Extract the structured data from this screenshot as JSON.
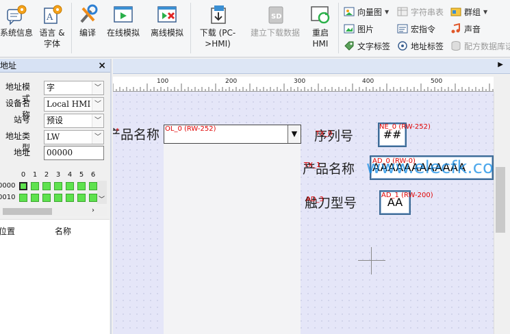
{
  "ribbon": {
    "big_buttons": [
      {
        "label": "系统信息",
        "icon": "system-info-icon",
        "enabled": true
      },
      {
        "label": "语言 &\n字体",
        "icon": "language-font-icon",
        "enabled": true
      },
      {
        "label": "编译",
        "icon": "compile-icon",
        "enabled": true
      },
      {
        "label": "在线模拟",
        "icon": "online-simulation-icon",
        "enabled": true
      },
      {
        "label": "离线模拟",
        "icon": "offline-simulation-icon",
        "enabled": true
      },
      {
        "label": "下载 (PC-\n>HMI)",
        "icon": "download-icon",
        "enabled": true
      },
      {
        "label": "建立下载数据",
        "icon": "build-download-data-icon",
        "enabled": false
      },
      {
        "label": "重启\nHMI",
        "icon": "restart-hmi-icon",
        "enabled": true
      }
    ],
    "small_col1": [
      {
        "label": "向量图",
        "icon": "vector-graphic-icon",
        "dropdown": true,
        "enabled": true
      },
      {
        "label": "图片",
        "icon": "picture-icon",
        "dropdown": false,
        "enabled": true
      },
      {
        "label": "文字标签",
        "icon": "text-tag-icon",
        "dropdown": false,
        "enabled": true
      }
    ],
    "small_col2": [
      {
        "label": "字符串表",
        "icon": "string-table-icon",
        "dropdown": false,
        "enabled": false
      },
      {
        "label": "宏指令",
        "icon": "macro-icon",
        "dropdown": false,
        "enabled": true
      },
      {
        "label": "地址标签",
        "icon": "address-tag-icon",
        "dropdown": false,
        "enabled": true
      }
    ],
    "small_col3": [
      {
        "label": "群组",
        "icon": "group-icon",
        "dropdown": true,
        "enabled": true
      },
      {
        "label": "声音",
        "icon": "sound-icon",
        "dropdown": false,
        "enabled": true
      },
      {
        "label": "配方数据库话",
        "icon": "recipe-db-icon",
        "dropdown": false,
        "enabled": false
      }
    ]
  },
  "left_panel": {
    "title": "地址",
    "close": "×",
    "fields": [
      {
        "label": "地址模式",
        "value": "字",
        "type": "select"
      },
      {
        "label": "设备名称",
        "value": "Local HMI",
        "type": "select"
      },
      {
        "label": "站号",
        "value": "预设",
        "type": "select"
      },
      {
        "label": "地址类型",
        "value": "LW",
        "type": "select"
      },
      {
        "label": "地址",
        "value": "00000",
        "type": "input"
      }
    ],
    "bit_headers": [
      "0",
      "1",
      "2",
      "3",
      "4",
      "5",
      "6"
    ],
    "bit_rows": [
      {
        "addr": "0000"
      },
      {
        "addr": "0010"
      }
    ],
    "list_columns": [
      "位置",
      "名称"
    ]
  },
  "editor": {
    "ruler_labels": [
      "100",
      "200",
      "300",
      "400",
      "500"
    ],
    "labels": [
      {
        "text": "产品名称",
        "cls": "left-product"
      },
      {
        "text": "序列号",
        "cls": "serial"
      },
      {
        "text": "产品名称",
        "cls": "product"
      },
      {
        "text": "触刀型号",
        "cls": "blade"
      }
    ],
    "tags": {
      "left_star": "*",
      "combo": "OL_0 (RW-252)",
      "serial_prefix": "TX_0",
      "serial_box": "NE_0 (RW-252)",
      "product_prefix": "TX_1",
      "product_box": "AD_0 (RW-0)",
      "blade_prefix": "AD_3",
      "blade_box": "AD_1 (RW-200)"
    },
    "boxes": {
      "serial": "##",
      "product": "AAAAAAAAAAAA",
      "blade": "AA"
    },
    "watermark": "www.elecfk.com",
    "colors": {
      "canvas": "#e5e6f8",
      "tag_red": "#e00000",
      "box_border": "#3e6c97",
      "bit_on": "#5ee24e"
    }
  }
}
